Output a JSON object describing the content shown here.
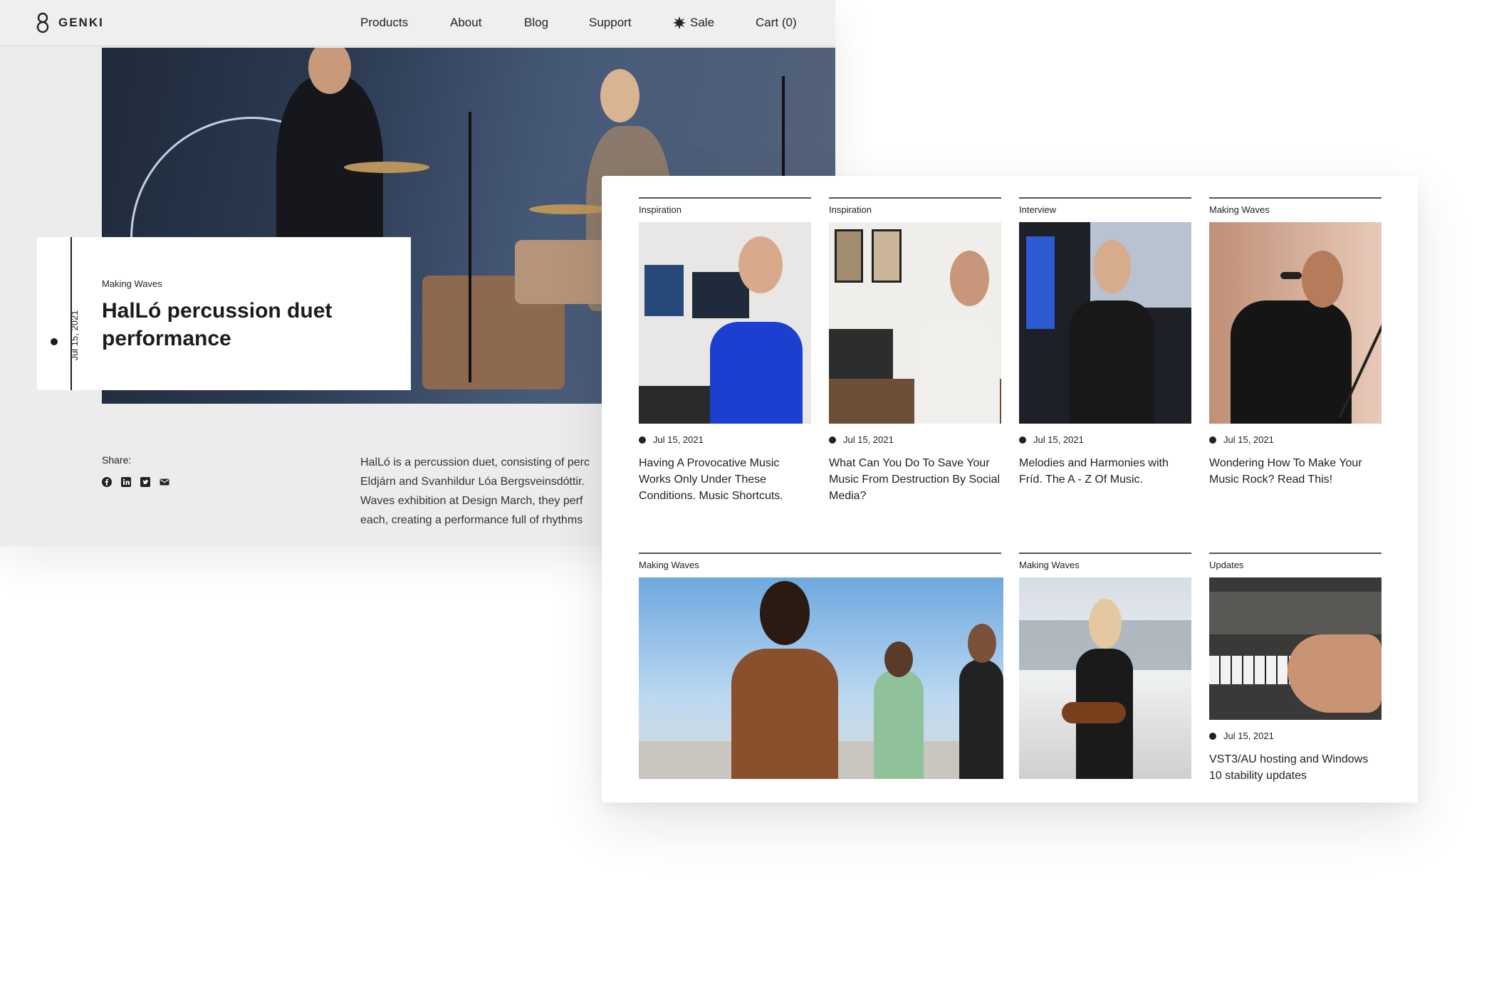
{
  "header": {
    "brand": "GENKI",
    "nav": {
      "products": "Products",
      "about": "About",
      "blog": "Blog",
      "support": "Support",
      "sale": "Sale",
      "cart": "Cart (0)"
    }
  },
  "article": {
    "category": "Making Waves",
    "title": "HalLó percussion duet performance",
    "date": "Jul 15, 2021",
    "share_label": "Share:",
    "share_icons": [
      "facebook-icon",
      "linkedin-icon",
      "twitter-icon",
      "email-icon"
    ],
    "body_lines": [
      "HalLó is a percussion duet, consisting of perc",
      "Eldjárn and Svanhildur Lóa Bergsveinsdóttir.",
      "Waves exhibition at Design March, they perf",
      "each, creating a performance full of rhythms"
    ]
  },
  "posts": [
    {
      "category": "Inspiration",
      "date": "Jul 15, 2021",
      "title": "Having A Provocative Music Works Only Under These Conditions. Music Shortcuts."
    },
    {
      "category": "Inspiration",
      "date": "Jul 15, 2021",
      "title": "What Can You Do To Save Your Music From Destruction By Social Media?"
    },
    {
      "category": "Interview",
      "date": "Jul 15, 2021",
      "title": "Melodies and Harmonies with Fríd. The A - Z Of Music."
    },
    {
      "category": "Making Waves",
      "date": "Jul 15, 2021",
      "title": "Wondering How To Make Your Music Rock? Read This!"
    },
    {
      "category": "Making Waves",
      "date": "",
      "title": ""
    },
    {
      "category": "Making Waves",
      "date": "",
      "title": ""
    },
    {
      "category": "Updates",
      "date": "Jul 15, 2021",
      "title": "VST3/AU hosting and Windows 10 stability updates"
    }
  ],
  "colors": {
    "text": "#1d1d1d",
    "back_bg": "#ececec",
    "card_bg": "#ffffff"
  }
}
